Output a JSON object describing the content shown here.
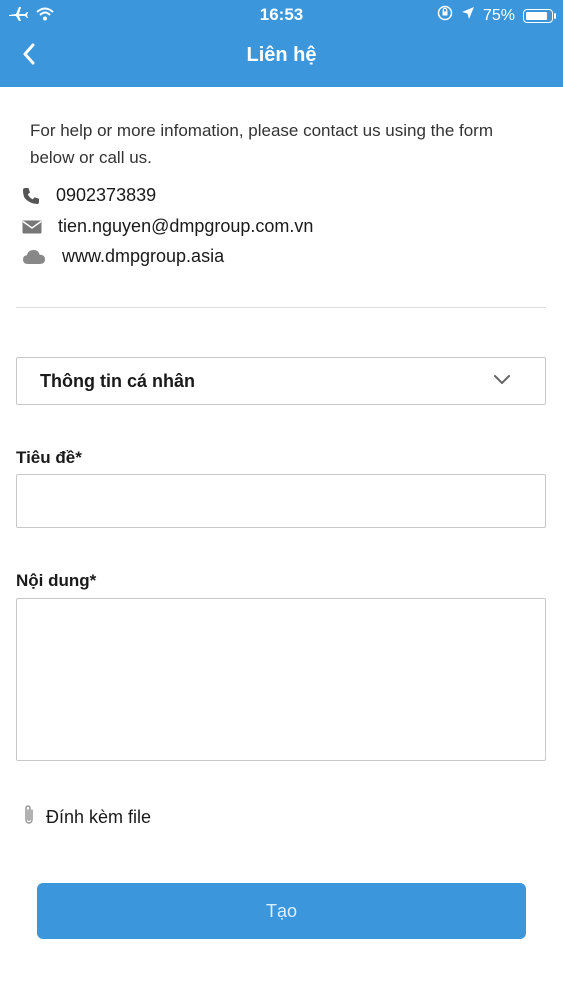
{
  "status_bar": {
    "time": "16:53",
    "battery": "75%"
  },
  "header": {
    "title": "Liên hệ",
    "bg_color": "#3b96dc"
  },
  "intro": {
    "text": "For help or more infomation, please contact us using the form below or call us."
  },
  "contacts": {
    "phone": "0902373839",
    "email": "tien.nguyen@dmpgroup.com.vn",
    "website": "www.dmpgroup.asia"
  },
  "form": {
    "category_select": {
      "selected": "Thông tin cá nhân"
    },
    "title_label": "Tiêu đề*",
    "title_value": "",
    "content_label": "Nội dung*",
    "content_value": "",
    "attach_label": "Đính kèm file",
    "submit_label": "Tạo"
  },
  "icons": {
    "back": "chevron-left-icon",
    "phone": "phone-icon",
    "email": "envelope-icon",
    "website": "cloud-icon",
    "select": "chevron-down-icon",
    "attach": "paperclip-icon"
  }
}
